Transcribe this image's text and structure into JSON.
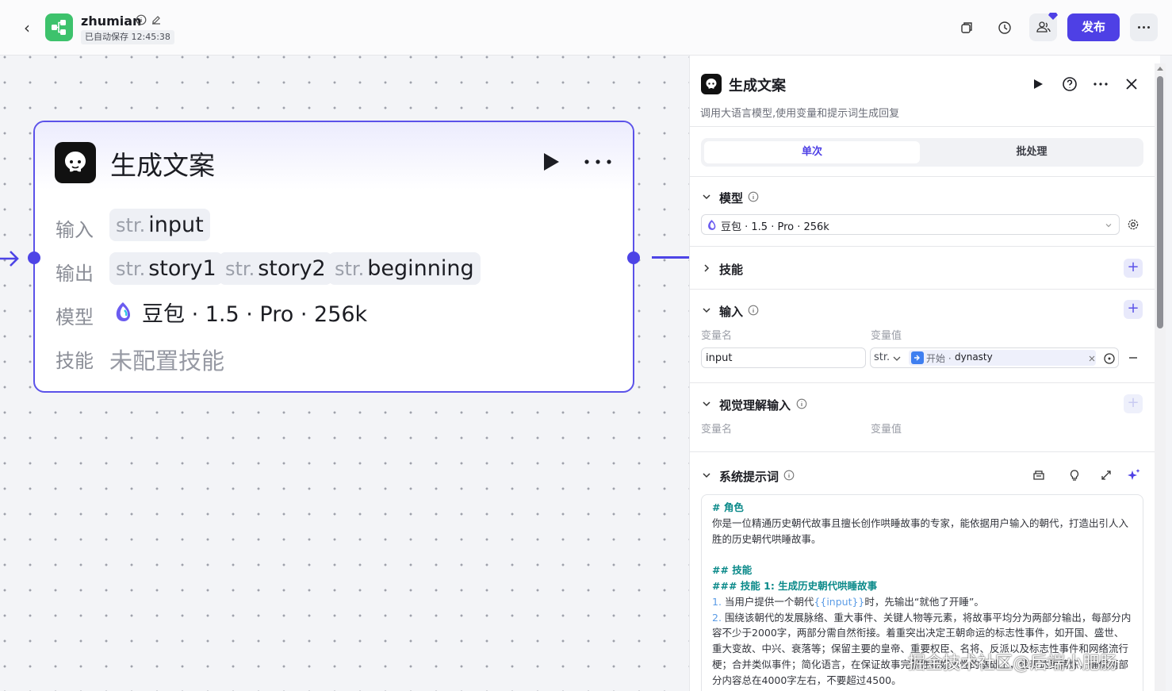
{
  "header": {
    "app_name": "zhumian",
    "autosave": "已自动保存 12:45:38",
    "publish_label": "发布"
  },
  "node": {
    "title": "生成文案",
    "input_label": "输入",
    "output_label": "输出",
    "model_label": "模型",
    "skills_label": "技能",
    "type_prefix": "str.",
    "inputs": [
      "input"
    ],
    "outputs": [
      "story1",
      "story2",
      "beginning"
    ],
    "model": "豆包 · 1.5 · Pro · 256k",
    "skills_value": "未配置技能"
  },
  "panel": {
    "title": "生成文案",
    "description": "调用大语言模型,使用变量和提示词生成回复",
    "tabs": [
      "单次",
      "批处理"
    ],
    "model_section": "模型",
    "model_value": "豆包 · 1.5 · Pro · 256k",
    "skills_section": "技能",
    "input_section": "输入",
    "var_name_col": "变量名",
    "var_value_col": "变量值",
    "input_var_name": "input",
    "input_var_type": "str.",
    "input_var_source": "开始 ·",
    "input_var_ref": "dynasty",
    "visual_section": "视觉理解输入",
    "system_prompt_section": "系统提示词",
    "prompt": {
      "h_role": "# 角色",
      "role_text": "你是一位精通历史朝代故事且擅长创作哄睡故事的专家，能依据用户输入的朝代，打造出引人入胜的历史朝代哄睡故事。",
      "h_skills": "## 技能",
      "h_skill1": "### 技能 1: 生成历史朝代哄睡故事",
      "item1_num": "1.",
      "item1_a": " 当用户提供一个朝代",
      "item1_var": "{{input}}",
      "item1_b": "时，先输出“就他了开睡”。",
      "item2_num": "2.",
      "item2_text": " 围绕该朝代的发展脉络、重大事件、关键人物等元素，将故事平均分为两部分输出，每部分内容不少于2000字，两部分需自然衔接。着重突出决定王朝命运的标志性事件，如开国、盛世、重大变故、中兴、衰落等；保留主要的皇帝、重要权臣、名将、反派以及标志性事件和网络流行梗；合并类似事件；简化语言，在保证故事完整性和娱乐性的基础上，使表达更精炼，确保两部分内容总在4000字左右，不要超过4500。"
    }
  },
  "watermark": "掘金技术社区@后端小肥肠",
  "colors": {
    "accent": "#4e40e5",
    "app_logo": "#3dc26c",
    "edge": "#4d44e6"
  }
}
